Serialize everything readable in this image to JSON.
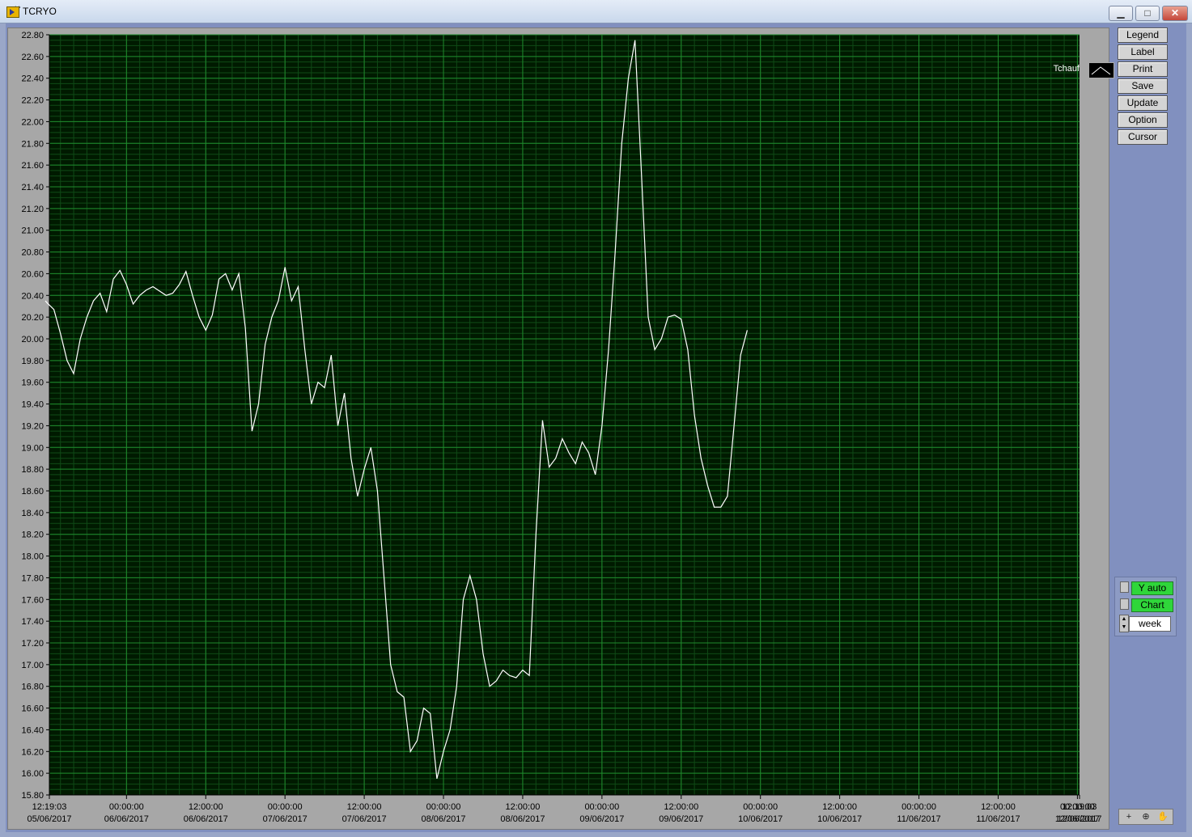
{
  "window": {
    "title": "TCRYO",
    "minimize": "▭",
    "restore": "⧉",
    "close": "✕"
  },
  "chart_data": {
    "type": "line",
    "ylim": [
      15.8,
      22.8
    ],
    "y_ticks": [
      "22.80",
      "22.60",
      "22.40",
      "22.20",
      "22.00",
      "21.80",
      "21.60",
      "21.40",
      "21.20",
      "21.00",
      "20.80",
      "20.60",
      "20.40",
      "20.20",
      "20.00",
      "19.80",
      "19.60",
      "19.40",
      "19.20",
      "19.00",
      "18.80",
      "18.60",
      "18.40",
      "18.20",
      "18.00",
      "17.80",
      "17.60",
      "17.40",
      "17.20",
      "17.00",
      "16.80",
      "16.60",
      "16.40",
      "16.20",
      "16.00",
      "15.80"
    ],
    "x_ticks": [
      {
        "time": "12:19:03",
        "date": "05/06/2017"
      },
      {
        "time": "00:00:00",
        "date": "06/06/2017"
      },
      {
        "time": "12:00:00",
        "date": "06/06/2017"
      },
      {
        "time": "00:00:00",
        "date": "07/06/2017"
      },
      {
        "time": "12:00:00",
        "date": "07/06/2017"
      },
      {
        "time": "00:00:00",
        "date": "08/06/2017"
      },
      {
        "time": "12:00:00",
        "date": "08/06/2017"
      },
      {
        "time": "00:00:00",
        "date": "09/06/2017"
      },
      {
        "time": "12:00:00",
        "date": "09/06/2017"
      },
      {
        "time": "00:00:00",
        "date": "10/06/2017"
      },
      {
        "time": "12:00:00",
        "date": "10/06/2017"
      },
      {
        "time": "00:00:00",
        "date": "11/06/2017"
      },
      {
        "time": "12:00:00",
        "date": "11/06/2017"
      },
      {
        "time": "00:00:00",
        "date": "12/06/2017"
      },
      {
        "time": "12:19:03",
        "date": "12/06/2017"
      }
    ],
    "series": [
      {
        "name": "Tchauf",
        "color": "#ffffff",
        "x_hours": [
          11.7,
          12,
          13,
          14,
          15,
          16,
          17,
          18,
          19,
          20,
          21,
          22,
          23,
          24,
          25,
          26,
          27,
          28,
          29,
          30,
          31,
          32,
          33,
          34,
          35,
          36,
          37,
          38,
          39,
          40,
          41,
          42,
          43,
          44,
          45,
          46,
          47,
          48,
          49,
          50,
          51,
          52,
          53,
          54,
          55,
          56,
          57,
          58,
          59,
          60,
          61,
          62,
          63,
          64,
          65,
          66,
          67,
          68,
          69,
          70,
          71,
          72,
          73,
          74,
          75,
          76,
          77,
          78,
          79,
          80,
          81,
          82,
          83,
          84,
          85,
          86,
          87,
          88,
          89,
          90,
          91,
          92,
          93,
          94,
          95,
          96,
          97,
          98,
          99,
          100,
          101,
          102,
          103,
          104,
          105,
          106,
          107,
          108,
          109,
          110,
          111,
          112,
          113,
          114,
          115,
          116,
          117,
          118,
          119,
          120,
          121,
          122,
          123,
          124,
          125,
          126,
          127,
          128,
          129,
          130,
          131,
          132,
          133,
          134,
          135,
          136,
          137,
          138,
          139,
          140,
          141,
          142,
          143,
          144,
          145,
          146,
          147,
          148,
          149,
          150,
          151,
          152,
          153,
          154,
          155,
          156,
          157,
          158,
          159,
          160,
          161,
          162,
          163,
          164,
          165,
          166,
          167,
          168.3
        ],
        "values": [
          20.35,
          20.33,
          20.27,
          20.05,
          19.8,
          19.68,
          20.0,
          20.2,
          20.35,
          20.42,
          20.25,
          20.55,
          20.63,
          20.5,
          20.32,
          20.4,
          20.45,
          20.48,
          20.44,
          20.4,
          20.42,
          20.5,
          20.62,
          20.4,
          20.2,
          20.08,
          20.22,
          20.55,
          20.6,
          20.45,
          20.6,
          20.1,
          19.15,
          19.4,
          19.95,
          20.2,
          20.35,
          20.66,
          20.35,
          20.48,
          19.9,
          19.4,
          19.6,
          19.55,
          19.85,
          19.2,
          19.5,
          18.9,
          18.55,
          18.8,
          19.0,
          18.6,
          17.8,
          17.0,
          16.75,
          16.7,
          16.2,
          16.3,
          16.6,
          16.55,
          15.95,
          16.2,
          16.4,
          16.8,
          17.6,
          17.82,
          17.6,
          17.1,
          16.8,
          16.85,
          16.95,
          16.9,
          16.88,
          16.95,
          16.9,
          18.2,
          19.25,
          18.82,
          18.9,
          19.08,
          18.95,
          18.85,
          19.05,
          18.95,
          18.75,
          19.2,
          19.9,
          20.8,
          21.8,
          22.4,
          22.75,
          21.5,
          20.2,
          19.9,
          20.0,
          20.2,
          20.22,
          20.18,
          19.9,
          19.3,
          18.9,
          18.65,
          18.45,
          18.45,
          18.55,
          19.2,
          19.85,
          20.08
        ],
        "x_unit": "hours since 05/06/2017 00:00"
      }
    ],
    "grid": true,
    "legend": "top-right"
  },
  "side_buttons": [
    "Legend",
    "Label",
    "Print",
    "Save",
    "Update",
    "Option",
    "Cursor"
  ],
  "controls": {
    "y_auto": "Y auto",
    "chart": "Chart",
    "period": "week",
    "y_auto_color": "#2fd63a"
  },
  "tools": {
    "crosshair": "+",
    "zoom": "⊕",
    "pan": "✋"
  }
}
